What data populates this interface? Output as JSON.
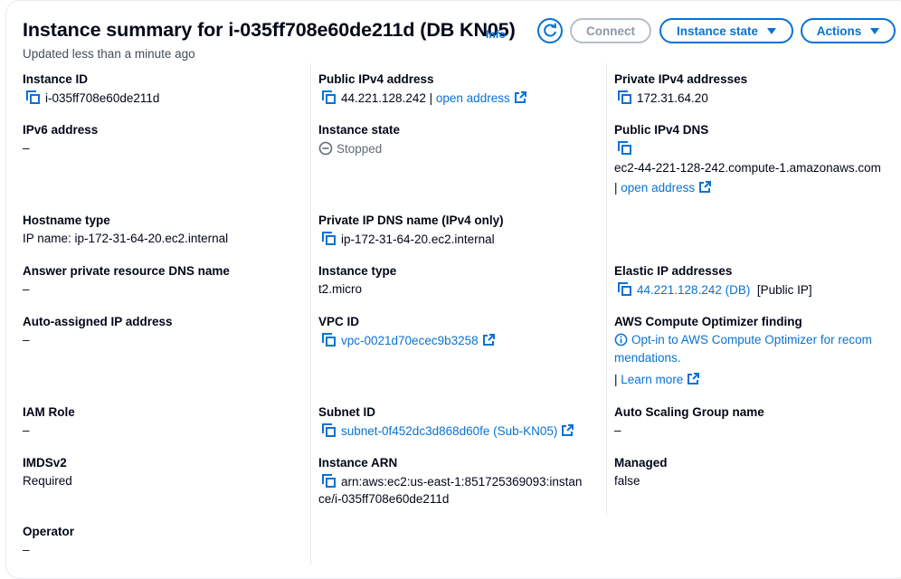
{
  "header": {
    "title": "Instance summary for i-035ff708e60de211d (DB KN05)",
    "info_label": "Info",
    "updated": "Updated less than a minute ago",
    "refresh_icon": "refresh-icon",
    "connect_label": "Connect",
    "instance_state_label": "Instance state",
    "actions_label": "Actions"
  },
  "col1": {
    "instance_id": {
      "label": "Instance ID",
      "value": "i-035ff708e60de211d"
    },
    "ipv6": {
      "label": "IPv6 address",
      "value": "–"
    },
    "hostname_type": {
      "label": "Hostname type",
      "value": "IP name: ip-172-31-64-20.ec2.internal"
    },
    "answer_dns": {
      "label": "Answer private resource DNS name",
      "value": "–"
    },
    "auto_ip": {
      "label": "Auto-assigned IP address",
      "value": "–"
    },
    "iam_role": {
      "label": "IAM Role",
      "value": "–"
    },
    "imdsv2": {
      "label": "IMDSv2",
      "value": "Required"
    },
    "operator": {
      "label": "Operator",
      "value": "–"
    }
  },
  "col2": {
    "public_ipv4": {
      "label": "Public IPv4 address",
      "value": "44.221.128.242",
      "sep": "|",
      "link": "open address"
    },
    "instance_state": {
      "label": "Instance state",
      "value": "Stopped"
    },
    "private_dns": {
      "label": "Private IP DNS name (IPv4 only)",
      "value": "ip-172-31-64-20.ec2.internal"
    },
    "instance_type": {
      "label": "Instance type",
      "value": "t2.micro"
    },
    "vpc_id": {
      "label": "VPC ID",
      "value": "vpc-0021d70ecec9b3258"
    },
    "subnet_id": {
      "label": "Subnet ID",
      "value": "subnet-0f452dc3d868d60fe (Sub-KN05)"
    },
    "instance_arn": {
      "label": "Instance ARN",
      "line1": "arn:aws:ec2:us-east-1:851725369093:instan",
      "line2": "ce/i-035ff708e60de211d"
    }
  },
  "col3": {
    "private_ipv4": {
      "label": "Private IPv4 addresses",
      "value": "172.31.64.20"
    },
    "public_dns": {
      "label": "Public IPv4 DNS",
      "value": "ec2-44-221-128-242.compute-1.amazonaws.com",
      "sep": "|",
      "link": "open address"
    },
    "elastic_ip": {
      "label": "Elastic IP addresses",
      "value": "44.221.128.242 (DB)",
      "tag": "[Public IP]"
    },
    "optimizer": {
      "label": "AWS Compute Optimizer finding",
      "line1": "Opt-in to AWS Compute Optimizer for recom",
      "line2": "mendations.",
      "sep": "|",
      "link": "Learn more"
    },
    "asg": {
      "label": "Auto Scaling Group name",
      "value": "–"
    },
    "managed": {
      "label": "Managed",
      "value": "false"
    }
  },
  "colors": {
    "link": "#0972d3",
    "border": "#e9ebed",
    "text": "#000716",
    "muted": "#5f6b7a"
  }
}
